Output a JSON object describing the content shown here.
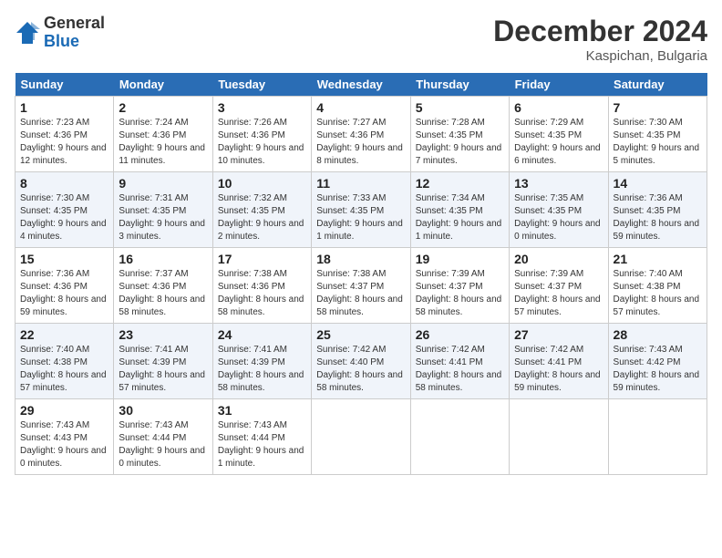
{
  "header": {
    "logo_general": "General",
    "logo_blue": "Blue",
    "month_title": "December 2024",
    "location": "Kaspichan, Bulgaria"
  },
  "weekdays": [
    "Sunday",
    "Monday",
    "Tuesday",
    "Wednesday",
    "Thursday",
    "Friday",
    "Saturday"
  ],
  "weeks": [
    [
      {
        "day": "1",
        "sunrise": "7:23 AM",
        "sunset": "4:36 PM",
        "daylight": "9 hours and 12 minutes."
      },
      {
        "day": "2",
        "sunrise": "7:24 AM",
        "sunset": "4:36 PM",
        "daylight": "9 hours and 11 minutes."
      },
      {
        "day": "3",
        "sunrise": "7:26 AM",
        "sunset": "4:36 PM",
        "daylight": "9 hours and 10 minutes."
      },
      {
        "day": "4",
        "sunrise": "7:27 AM",
        "sunset": "4:36 PM",
        "daylight": "9 hours and 8 minutes."
      },
      {
        "day": "5",
        "sunrise": "7:28 AM",
        "sunset": "4:35 PM",
        "daylight": "9 hours and 7 minutes."
      },
      {
        "day": "6",
        "sunrise": "7:29 AM",
        "sunset": "4:35 PM",
        "daylight": "9 hours and 6 minutes."
      },
      {
        "day": "7",
        "sunrise": "7:30 AM",
        "sunset": "4:35 PM",
        "daylight": "9 hours and 5 minutes."
      }
    ],
    [
      {
        "day": "8",
        "sunrise": "7:30 AM",
        "sunset": "4:35 PM",
        "daylight": "9 hours and 4 minutes."
      },
      {
        "day": "9",
        "sunrise": "7:31 AM",
        "sunset": "4:35 PM",
        "daylight": "9 hours and 3 minutes."
      },
      {
        "day": "10",
        "sunrise": "7:32 AM",
        "sunset": "4:35 PM",
        "daylight": "9 hours and 2 minutes."
      },
      {
        "day": "11",
        "sunrise": "7:33 AM",
        "sunset": "4:35 PM",
        "daylight": "9 hours and 1 minute."
      },
      {
        "day": "12",
        "sunrise": "7:34 AM",
        "sunset": "4:35 PM",
        "daylight": "9 hours and 1 minute."
      },
      {
        "day": "13",
        "sunrise": "7:35 AM",
        "sunset": "4:35 PM",
        "daylight": "9 hours and 0 minutes."
      },
      {
        "day": "14",
        "sunrise": "7:36 AM",
        "sunset": "4:35 PM",
        "daylight": "8 hours and 59 minutes."
      }
    ],
    [
      {
        "day": "15",
        "sunrise": "7:36 AM",
        "sunset": "4:36 PM",
        "daylight": "8 hours and 59 minutes."
      },
      {
        "day": "16",
        "sunrise": "7:37 AM",
        "sunset": "4:36 PM",
        "daylight": "8 hours and 58 minutes."
      },
      {
        "day": "17",
        "sunrise": "7:38 AM",
        "sunset": "4:36 PM",
        "daylight": "8 hours and 58 minutes."
      },
      {
        "day": "18",
        "sunrise": "7:38 AM",
        "sunset": "4:37 PM",
        "daylight": "8 hours and 58 minutes."
      },
      {
        "day": "19",
        "sunrise": "7:39 AM",
        "sunset": "4:37 PM",
        "daylight": "8 hours and 58 minutes."
      },
      {
        "day": "20",
        "sunrise": "7:39 AM",
        "sunset": "4:37 PM",
        "daylight": "8 hours and 57 minutes."
      },
      {
        "day": "21",
        "sunrise": "7:40 AM",
        "sunset": "4:38 PM",
        "daylight": "8 hours and 57 minutes."
      }
    ],
    [
      {
        "day": "22",
        "sunrise": "7:40 AM",
        "sunset": "4:38 PM",
        "daylight": "8 hours and 57 minutes."
      },
      {
        "day": "23",
        "sunrise": "7:41 AM",
        "sunset": "4:39 PM",
        "daylight": "8 hours and 57 minutes."
      },
      {
        "day": "24",
        "sunrise": "7:41 AM",
        "sunset": "4:39 PM",
        "daylight": "8 hours and 58 minutes."
      },
      {
        "day": "25",
        "sunrise": "7:42 AM",
        "sunset": "4:40 PM",
        "daylight": "8 hours and 58 minutes."
      },
      {
        "day": "26",
        "sunrise": "7:42 AM",
        "sunset": "4:41 PM",
        "daylight": "8 hours and 58 minutes."
      },
      {
        "day": "27",
        "sunrise": "7:42 AM",
        "sunset": "4:41 PM",
        "daylight": "8 hours and 59 minutes."
      },
      {
        "day": "28",
        "sunrise": "7:43 AM",
        "sunset": "4:42 PM",
        "daylight": "8 hours and 59 minutes."
      }
    ],
    [
      {
        "day": "29",
        "sunrise": "7:43 AM",
        "sunset": "4:43 PM",
        "daylight": "9 hours and 0 minutes."
      },
      {
        "day": "30",
        "sunrise": "7:43 AM",
        "sunset": "4:44 PM",
        "daylight": "9 hours and 0 minutes."
      },
      {
        "day": "31",
        "sunrise": "7:43 AM",
        "sunset": "4:44 PM",
        "daylight": "9 hours and 1 minute."
      },
      null,
      null,
      null,
      null
    ]
  ]
}
